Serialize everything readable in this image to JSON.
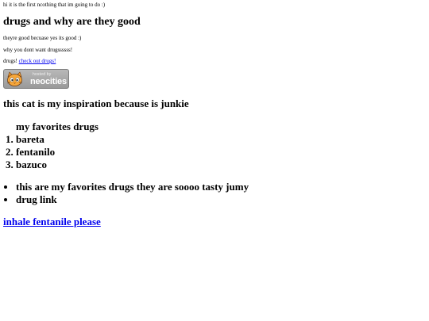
{
  "intro_text": "hi it is the first ncothing that im going to do :)",
  "heading_main": "drugs and why are they good",
  "paragraphs": {
    "p1": "theyre good becuase yes its good :)",
    "p2": "why you dont want drugssssss!",
    "p3_prefix": "drugs! ",
    "p3_link": "check out drugs!"
  },
  "badge": {
    "hosted_text": "hosted by",
    "brand_text": "neocities",
    "icon": "neocities-cat-icon"
  },
  "heading_cat": "this cat is my inspiration because is junkie",
  "favorites": {
    "caption": "my favorites drugs",
    "items": [
      "bareta",
      "fentanilo",
      "bazuco"
    ]
  },
  "bullets": [
    "this are my favorites drugs they are soooo tasty jumy",
    "drug link"
  ],
  "big_link": "inhale fentanile please",
  "colors": {
    "link": "#0000ee",
    "badge_bg": "#a9a9a9",
    "text": "#000000"
  }
}
